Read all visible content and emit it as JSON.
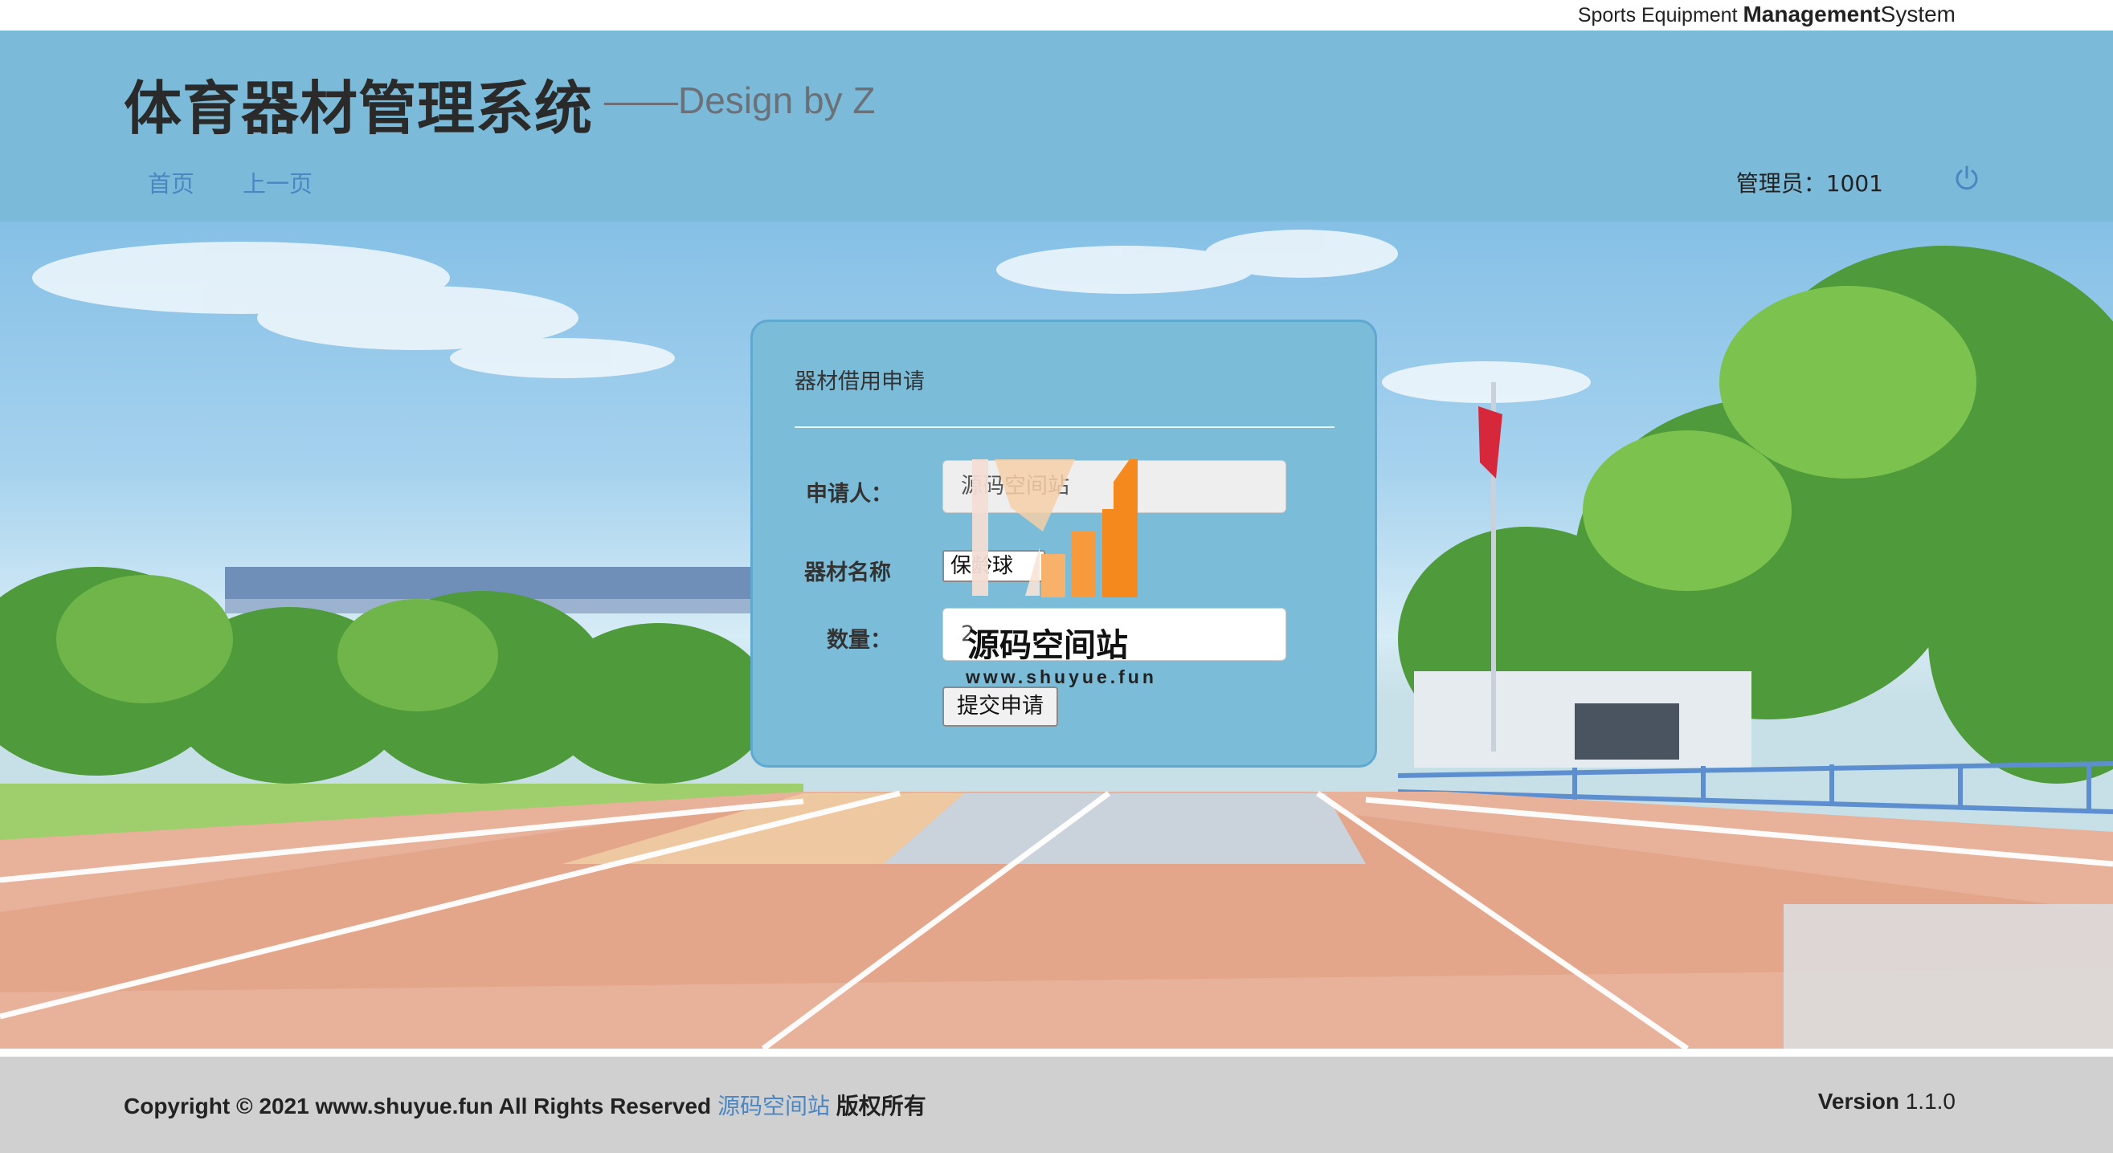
{
  "topbar": {
    "brand_prefix": "Sports Equipment ",
    "brand_bold": "Management",
    "brand_suffix": "System"
  },
  "header": {
    "title": "体育器材管理系统",
    "subtitle": "——Design by Z",
    "nav": [
      {
        "label": "首页"
      },
      {
        "label": "上一页"
      }
    ],
    "admin_label": "管理员：",
    "admin_id": "1001",
    "logout_icon": "power-icon"
  },
  "form": {
    "title": "器材借用申请",
    "applicant_label": "申请人：",
    "applicant_value": "源码空间站",
    "equipment_label": "器材名称",
    "equipment_selected": "保龄球",
    "quantity_label": "数量：",
    "quantity_value": "2",
    "submit_label": "提交申请"
  },
  "watermark": {
    "text": "源码空间站",
    "url": "www.shuyue.fun"
  },
  "footer": {
    "copyright": "Copyright © 2021 www.shuyue.fun All Rights Reserved ",
    "copyright_link": "源码空间站",
    "copyright_suffix": " 版权所有",
    "version_label": "Version",
    "version_value": "1.1.0"
  },
  "colors": {
    "header_bg": "#7bbbd9",
    "card_bg": "#7bbcd9",
    "link": "#4b86c2",
    "footer_bg": "#d0d0d0",
    "watermark_orange": "#f5891e"
  }
}
